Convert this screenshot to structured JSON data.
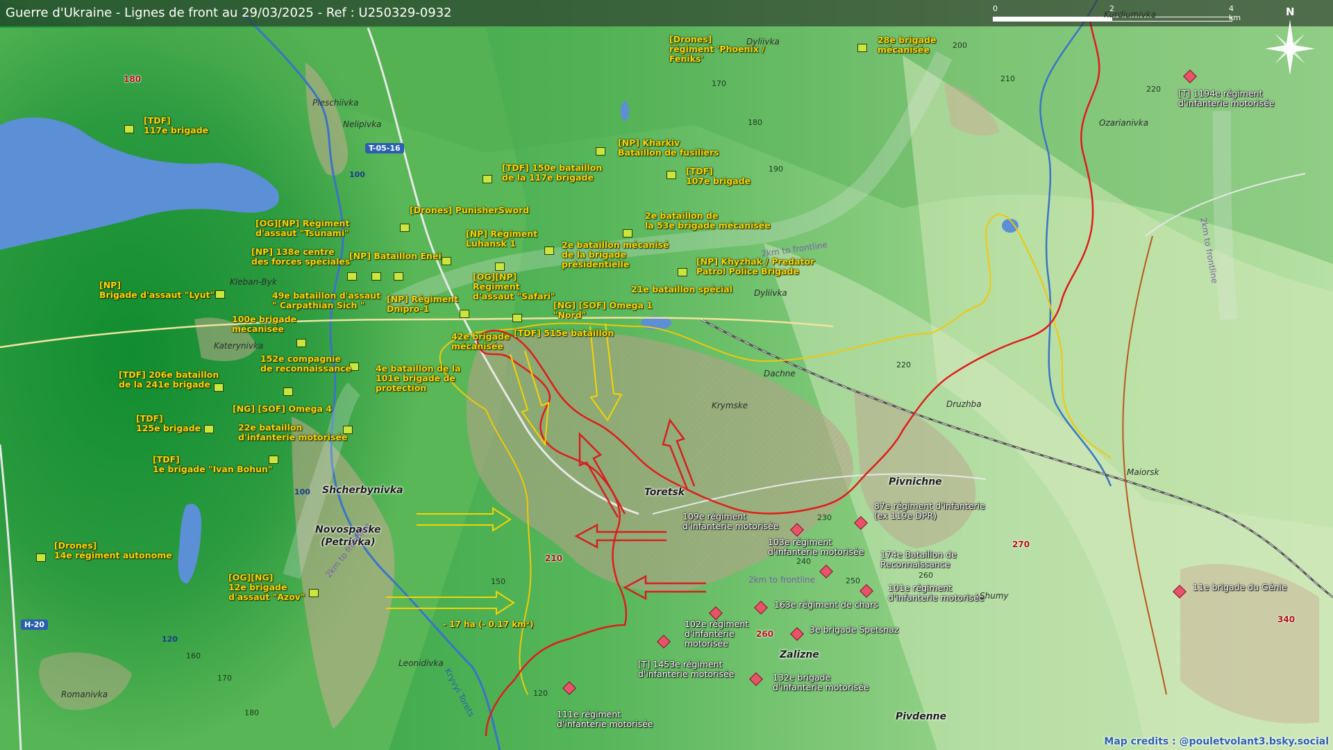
{
  "title": "Guerre d'Ukraine - Lignes de front au 29/03/2025 - Ref : U250329-0932",
  "scale": {
    "zero": "0",
    "mid": "2",
    "end": "4 km"
  },
  "compass": {
    "north": "N"
  },
  "colors": {
    "ukraine_units": "#f6d400",
    "russia_units": "#ffffff",
    "front_line": "#e01b1b",
    "ua_arrow": "#f6d400",
    "ru_arrow": "#d42020"
  },
  "units_ua": [
    {
      "text": "[TDF]\n117e brigade"
    },
    {
      "text": "[Drones]\nrégiment 'Phoenix /\nFeniks'"
    },
    {
      "text": "28e brigade\nmécanisée"
    },
    {
      "text": "[NP] Kharkiv\nBataillon de fusiliers"
    },
    {
      "text": "[TDF] 150e bataillon\nde la 117e brigade"
    },
    {
      "text": "[TDF]\n107e brigade"
    },
    {
      "text": "[Drones] PunisherSword"
    },
    {
      "text": "2e bataillon de\nla 53e brigade mécanisée"
    },
    {
      "text": "[OG][NP] Régiment\nd'assaut \"Tsunami\""
    },
    {
      "text": "[NP] Régiment\nLuhansk 1"
    },
    {
      "text": "2e bataillon mécanisé\nde la brigade\nprésidentielle"
    },
    {
      "text": "[NP] 138e centre\ndes forces spéciales"
    },
    {
      "text": "[NP] Bataillon Enei"
    },
    {
      "text": "[NP] Khyzhak / Predator\nPatrol Police Brigade"
    },
    {
      "text": "[OG][NP]\nRégiment\nd'assaut \"Safari\""
    },
    {
      "text": "21e bataillon spécial"
    },
    {
      "text": "[NP]\nBrigade d'assaut \"Lyut\""
    },
    {
      "text": "49e bataillon d'assaut\n\" Carpathian Sich \""
    },
    {
      "text": "[NP] Régiment\nDnipro-1"
    },
    {
      "text": "[NG] [SOF] Omega 1\n\"Nord\""
    },
    {
      "text": "100e brigade\nmécanisée"
    },
    {
      "text": "42e brigade\nmécanisée"
    },
    {
      "text": "[TDF] 515e bataillon"
    },
    {
      "text": "152e compagnie\nde reconnaissance"
    },
    {
      "text": "4e bataillon de la\n101e brigade de\nprotection"
    },
    {
      "text": "[TDF] 206e bataillon\nde la 241e brigade"
    },
    {
      "text": "[NG] [SOF] Omega 4"
    },
    {
      "text": "[TDF]\n125e brigade"
    },
    {
      "text": "22e bataillon\nd'infanterie motorisée"
    },
    {
      "text": "[TDF]\n1e brigade \"Ivan Bohun\""
    },
    {
      "text": "[Drones]\n14e régiment autonome"
    },
    {
      "text": "[OG][NG]\n12e brigade\nd'assaut \"Azov\""
    }
  ],
  "units_ru": [
    {
      "text": "[T] 1194e régiment\nd'infanterie motorisée"
    },
    {
      "text": "109e régiment\nd'infanterie motorisée"
    },
    {
      "text": "87e régiment d'infanterie\n(ex 119e DPR)"
    },
    {
      "text": "103e régiment\nd'infanterie motorisée"
    },
    {
      "text": "174e Bataillon de\nReconnaissance"
    },
    {
      "text": "101e régiment\nd'infanterie motorisée"
    },
    {
      "text": "163e régiment de chars"
    },
    {
      "text": "11e brigade du Génie"
    },
    {
      "text": "102e régiment\nd'infanterie\nmotorisée"
    },
    {
      "text": "3e brigade Spetsnaz"
    },
    {
      "text": "[T] 1453e régiment\nd'infanterie motorisée"
    },
    {
      "text": "132e brigade\nd'infanterie motorisée"
    },
    {
      "text": "111e régiment\nd'infanterie motorisée"
    }
  ],
  "places": [
    {
      "name": "Dyliivka"
    },
    {
      "name": "Kurdiumivka"
    },
    {
      "name": "Pleschiivka"
    },
    {
      "name": "Nelipivka"
    },
    {
      "name": "Ozarianivka"
    },
    {
      "name": "Kleban-Byk"
    },
    {
      "name": "Katerynivka"
    },
    {
      "name": "Dyliivka"
    },
    {
      "name": "Dachne"
    },
    {
      "name": "Krymske"
    },
    {
      "name": "Druzhba"
    },
    {
      "name": "Toretsk",
      "major": true
    },
    {
      "name": "Pivnichne",
      "major": true
    },
    {
      "name": "Shcherbynivka",
      "major": true
    },
    {
      "name": "Novospaske\n(Petrivka)",
      "major": true
    },
    {
      "name": "Maiorsk"
    },
    {
      "name": "Shumy"
    },
    {
      "name": "Zalizne",
      "major": true
    },
    {
      "name": "Leonidivka"
    },
    {
      "name": "Romanivka"
    },
    {
      "name": "Pivdenne",
      "major": true
    }
  ],
  "elevations": [
    {
      "v": "180",
      "red": true
    },
    {
      "v": "170"
    },
    {
      "v": "180"
    },
    {
      "v": "190"
    },
    {
      "v": "200"
    },
    {
      "v": "210"
    },
    {
      "v": "220"
    },
    {
      "v": "220"
    },
    {
      "v": "230"
    },
    {
      "v": "240"
    },
    {
      "v": "250"
    },
    {
      "v": "260"
    },
    {
      "v": "270",
      "red": true
    },
    {
      "v": "260",
      "red": true
    },
    {
      "v": "210",
      "red": true
    },
    {
      "v": "150"
    },
    {
      "v": "120"
    },
    {
      "v": "160"
    },
    {
      "v": "170"
    },
    {
      "v": "180"
    },
    {
      "v": "340",
      "red": true
    }
  ],
  "roads": [
    {
      "label": "T-05-16",
      "style": "blue"
    },
    {
      "label": "H-20",
      "style": "blue"
    },
    {
      "label": "100",
      "style": "plain"
    },
    {
      "label": "100",
      "style": "plain"
    },
    {
      "label": "120",
      "style": "plain"
    }
  ],
  "frontline_labels": [
    "2km to frontline",
    "2km to frontline",
    "2km to frontline",
    "2km to frontline"
  ],
  "river_label": "Kryvyi Torets",
  "area_note": "- 17 ha (- 0.17 km²)",
  "credits": "Map credits : @pouletvolant3.bsky.social"
}
